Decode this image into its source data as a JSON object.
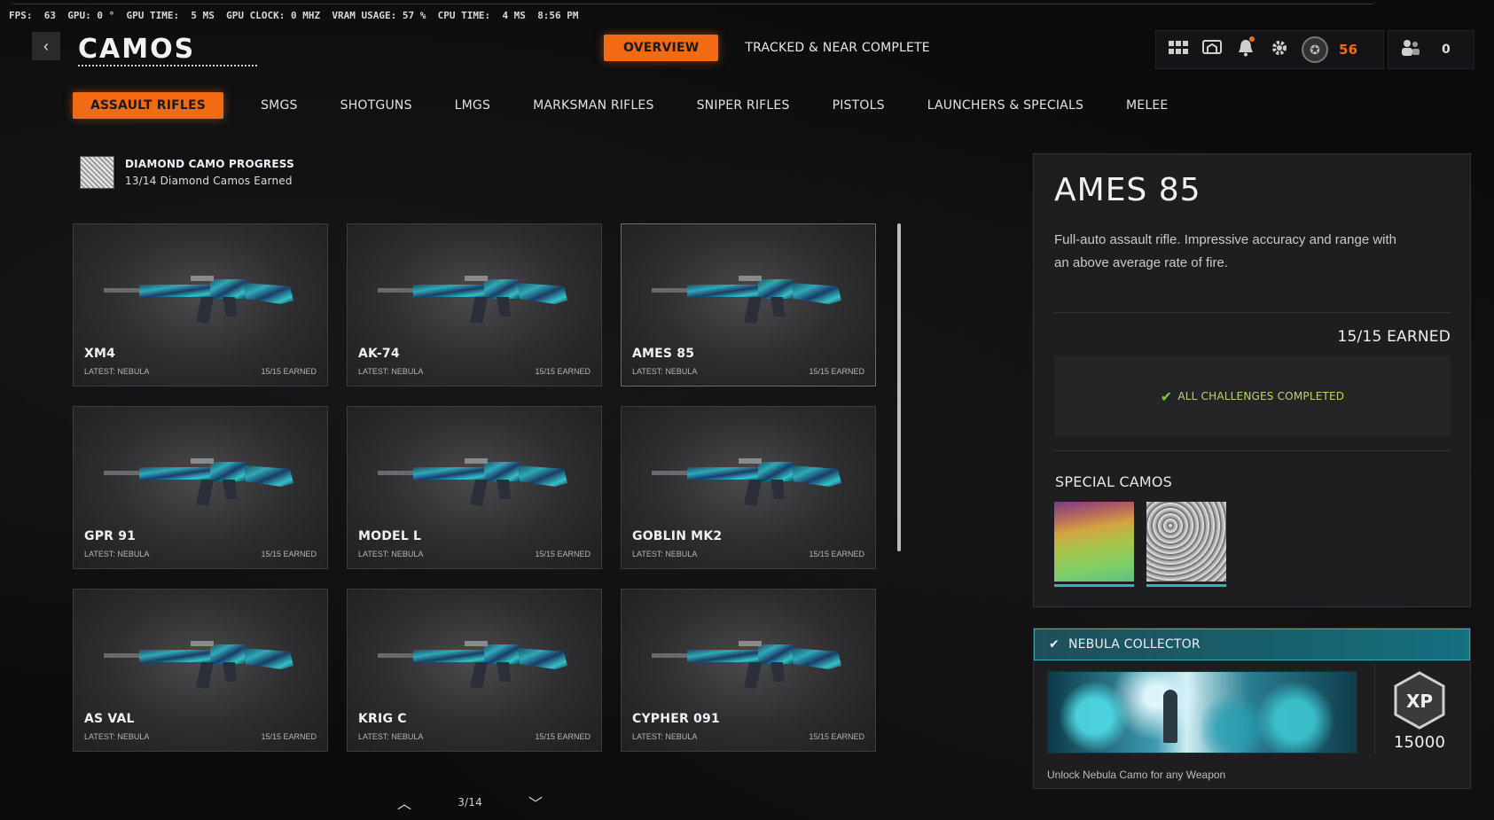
{
  "perf": {
    "fps_label": "FPS:",
    "fps": "63",
    "gpu_label": "GPU:",
    "gpu": "0 °",
    "gpu_time_label": "GPU TIME:",
    "gpu_time": "5 MS",
    "gpu_clock_label": "GPU CLOCK:",
    "gpu_clock": "0 MHZ",
    "vram_label": "VRAM USAGE:",
    "vram": "57 %",
    "cpu_time_label": "CPU TIME:",
    "cpu_time": "4 MS",
    "clock": "8:56 PM"
  },
  "header": {
    "back_icon": "‹",
    "title": "CAMOS",
    "tabs": [
      {
        "label": "OVERVIEW",
        "active": true
      },
      {
        "label": "TRACKED & NEAR COMPLETE",
        "active": false
      }
    ],
    "level": "56",
    "party_count": "0",
    "icons": [
      "grid-icon",
      "theater-icon",
      "bell-icon",
      "gear-icon",
      "prestige-icon",
      "party-icon"
    ]
  },
  "categories": [
    {
      "label": "ASSAULT RIFLES",
      "active": true
    },
    {
      "label": "SMGS"
    },
    {
      "label": "SHOTGUNS"
    },
    {
      "label": "LMGS"
    },
    {
      "label": "MARKSMAN RIFLES"
    },
    {
      "label": "SNIPER RIFLES"
    },
    {
      "label": "PISTOLS"
    },
    {
      "label": "LAUNCHERS & SPECIALS"
    },
    {
      "label": "MELEE"
    }
  ],
  "diamond_progress": {
    "title": "DIAMOND CAMO PROGRESS",
    "subtitle": "13/14 Diamond Camos Earned"
  },
  "weapons": [
    {
      "name": "XM4",
      "latest": "LATEST: NEBULA",
      "earned": "15/15 EARNED"
    },
    {
      "name": "AK-74",
      "latest": "LATEST: NEBULA",
      "earned": "15/15 EARNED"
    },
    {
      "name": "AMES 85",
      "latest": "LATEST: NEBULA",
      "earned": "15/15 EARNED"
    },
    {
      "name": "GPR 91",
      "latest": "LATEST: NEBULA",
      "earned": "15/15 EARNED"
    },
    {
      "name": "MODEL L",
      "latest": "LATEST: NEBULA",
      "earned": "15/15 EARNED"
    },
    {
      "name": "GOBLIN MK2",
      "latest": "LATEST: NEBULA",
      "earned": "15/15 EARNED"
    },
    {
      "name": "AS VAL",
      "latest": "LATEST: NEBULA",
      "earned": "15/15 EARNED"
    },
    {
      "name": "KRIG C",
      "latest": "LATEST: NEBULA",
      "earned": "15/15 EARNED"
    },
    {
      "name": "CYPHER 091",
      "latest": "LATEST: NEBULA",
      "earned": "15/15 EARNED"
    }
  ],
  "pager": {
    "up_icon": "︿",
    "page": "3/14",
    "down_icon": "﹀"
  },
  "detail": {
    "name": "AMES 85",
    "description": "Full-auto assault rifle.  Impressive accuracy and range with an above average rate of fire.",
    "earned": "15/15 EARNED",
    "completed": "ALL CHALLENGES COMPLETED",
    "special_label": "SPECIAL CAMOS"
  },
  "reward": {
    "title": "NEBULA COLLECTOR",
    "xp": "15000",
    "xp_badge": "XP",
    "description": "Unlock Nebula Camo for any Weapon"
  },
  "colors": {
    "accent": "#f26a12",
    "teal": "#2cb3c6",
    "check": "#7fc64a"
  }
}
